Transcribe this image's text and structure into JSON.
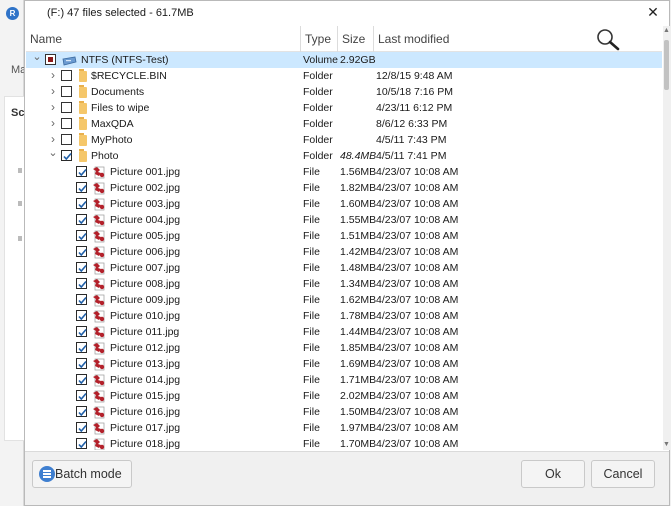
{
  "background": {
    "logo_letter": "R",
    "partial_text_1": "Ma",
    "partial_text_2": "Sc"
  },
  "dialog": {
    "title": "(F:) 47 files selected - 61.7MB",
    "close_glyph": "✕"
  },
  "columns": {
    "name": "Name",
    "type": "Type",
    "size": "Size",
    "modified": "Last modified"
  },
  "rows": [
    {
      "level": 0,
      "expand": "open",
      "check": "partial",
      "icon": "drive-icon",
      "name": "NTFS (NTFS-Test)",
      "type": "Volume",
      "size": "2.92GB",
      "modified": "",
      "selected": true
    },
    {
      "level": 1,
      "expand": "closed",
      "check": "none",
      "icon": "folder-icon",
      "name": "$RECYCLE.BIN",
      "type": "Folder",
      "size": "",
      "modified": "12/8/15 9:48 AM"
    },
    {
      "level": 1,
      "expand": "closed",
      "check": "none",
      "icon": "folder-icon",
      "name": "Documents",
      "type": "Folder",
      "size": "",
      "modified": "10/5/18 7:16 PM"
    },
    {
      "level": 1,
      "expand": "closed",
      "check": "none",
      "icon": "folder-icon",
      "name": "Files to wipe",
      "type": "Folder",
      "size": "",
      "modified": "4/23/11 6:12 PM"
    },
    {
      "level": 1,
      "expand": "closed",
      "check": "none",
      "icon": "folder-icon",
      "name": "MaxQDA",
      "type": "Folder",
      "size": "",
      "modified": "8/6/12 6:33 PM"
    },
    {
      "level": 1,
      "expand": "closed",
      "check": "none",
      "icon": "folder-icon",
      "name": "MyPhoto",
      "type": "Folder",
      "size": "",
      "modified": "4/5/11 7:43 PM"
    },
    {
      "level": 1,
      "expand": "open",
      "check": "checked",
      "icon": "folder-icon",
      "name": "Photo",
      "type": "Folder",
      "size": "48.4MB",
      "size_italic": true,
      "modified": "4/5/11 7:41 PM"
    },
    {
      "level": 2,
      "check": "checked",
      "icon": "image-file-icon",
      "name": "Picture 001.jpg",
      "type": "File",
      "size": "1.56MB",
      "modified": "4/23/07 10:08 AM"
    },
    {
      "level": 2,
      "check": "checked",
      "icon": "image-file-icon",
      "name": "Picture 002.jpg",
      "type": "File",
      "size": "1.82MB",
      "modified": "4/23/07 10:08 AM"
    },
    {
      "level": 2,
      "check": "checked",
      "icon": "image-file-icon",
      "name": "Picture 003.jpg",
      "type": "File",
      "size": "1.60MB",
      "modified": "4/23/07 10:08 AM"
    },
    {
      "level": 2,
      "check": "checked",
      "icon": "image-file-icon",
      "name": "Picture 004.jpg",
      "type": "File",
      "size": "1.55MB",
      "modified": "4/23/07 10:08 AM"
    },
    {
      "level": 2,
      "check": "checked",
      "icon": "image-file-icon",
      "name": "Picture 005.jpg",
      "type": "File",
      "size": "1.51MB",
      "modified": "4/23/07 10:08 AM"
    },
    {
      "level": 2,
      "check": "checked",
      "icon": "image-file-icon",
      "name": "Picture 006.jpg",
      "type": "File",
      "size": "1.42MB",
      "modified": "4/23/07 10:08 AM"
    },
    {
      "level": 2,
      "check": "checked",
      "icon": "image-file-icon",
      "name": "Picture 007.jpg",
      "type": "File",
      "size": "1.48MB",
      "modified": "4/23/07 10:08 AM"
    },
    {
      "level": 2,
      "check": "checked",
      "icon": "image-file-icon",
      "name": "Picture 008.jpg",
      "type": "File",
      "size": "1.34MB",
      "modified": "4/23/07 10:08 AM"
    },
    {
      "level": 2,
      "check": "checked",
      "icon": "image-file-icon",
      "name": "Picture 009.jpg",
      "type": "File",
      "size": "1.62MB",
      "modified": "4/23/07 10:08 AM"
    },
    {
      "level": 2,
      "check": "checked",
      "icon": "image-file-icon",
      "name": "Picture 010.jpg",
      "type": "File",
      "size": "1.78MB",
      "modified": "4/23/07 10:08 AM"
    },
    {
      "level": 2,
      "check": "checked",
      "icon": "image-file-icon",
      "name": "Picture 011.jpg",
      "type": "File",
      "size": "1.44MB",
      "modified": "4/23/07 10:08 AM"
    },
    {
      "level": 2,
      "check": "checked",
      "icon": "image-file-icon",
      "name": "Picture 012.jpg",
      "type": "File",
      "size": "1.85MB",
      "modified": "4/23/07 10:08 AM"
    },
    {
      "level": 2,
      "check": "checked",
      "icon": "image-file-icon",
      "name": "Picture 013.jpg",
      "type": "File",
      "size": "1.69MB",
      "modified": "4/23/07 10:08 AM"
    },
    {
      "level": 2,
      "check": "checked",
      "icon": "image-file-icon",
      "name": "Picture 014.jpg",
      "type": "File",
      "size": "1.71MB",
      "modified": "4/23/07 10:08 AM"
    },
    {
      "level": 2,
      "check": "checked",
      "icon": "image-file-icon",
      "name": "Picture 015.jpg",
      "type": "File",
      "size": "2.02MB",
      "modified": "4/23/07 10:08 AM"
    },
    {
      "level": 2,
      "check": "checked",
      "icon": "image-file-icon",
      "name": "Picture 016.jpg",
      "type": "File",
      "size": "1.50MB",
      "modified": "4/23/07 10:08 AM"
    },
    {
      "level": 2,
      "check": "checked",
      "icon": "image-file-icon",
      "name": "Picture 017.jpg",
      "type": "File",
      "size": "1.97MB",
      "modified": "4/23/07 10:08 AM"
    },
    {
      "level": 2,
      "check": "checked",
      "icon": "image-file-icon",
      "name": "Picture 018.jpg",
      "type": "File",
      "size": "1.70MB",
      "modified": "4/23/07 10:08 AM"
    }
  ],
  "footer": {
    "batch_label": "Batch mode",
    "ok_label": "Ok",
    "cancel_label": "Cancel"
  },
  "colors": {
    "selection": "#cce8ff",
    "check": "#1f5fa8",
    "partial": "#8b1a1a",
    "folder": "#f5c76a",
    "image_file": "#b3202a"
  }
}
